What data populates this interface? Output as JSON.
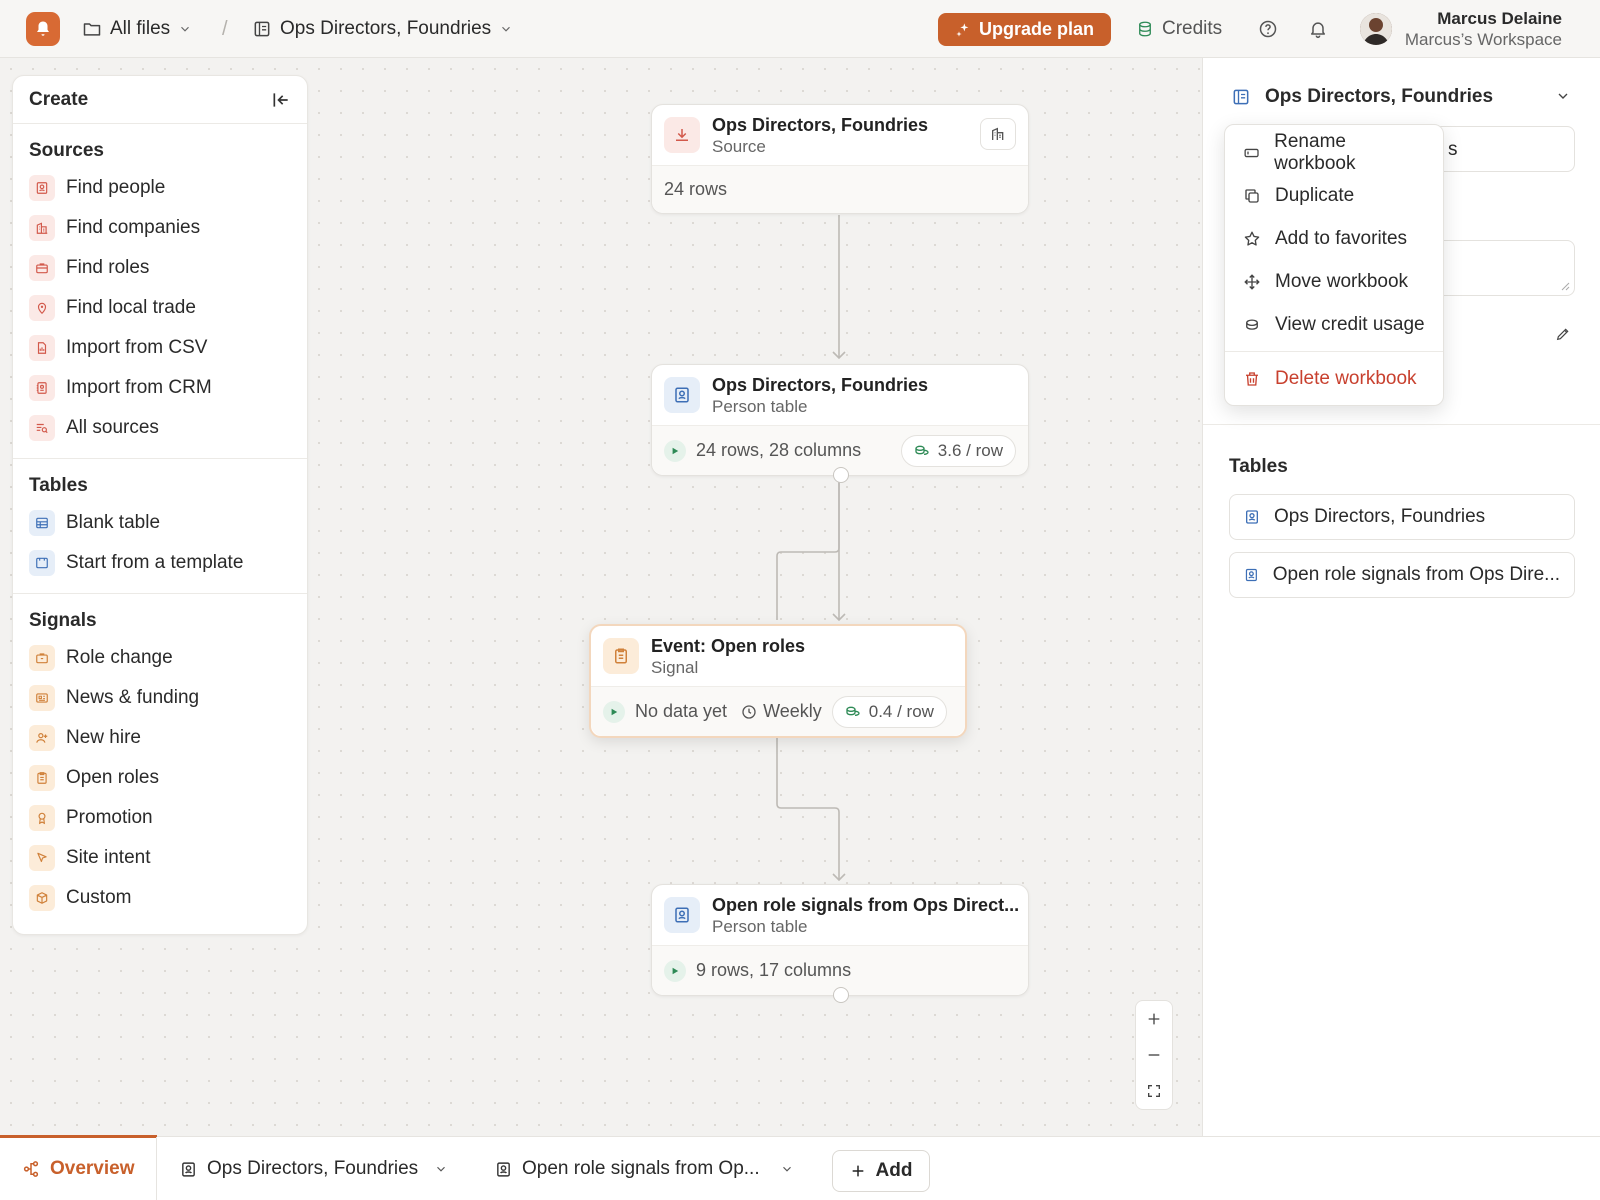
{
  "topbar": {
    "all_files": "All files",
    "workbook": "Ops Directors, Foundries",
    "upgrade": "Upgrade plan",
    "credits": "Credits",
    "user_name": "Marcus Delaine",
    "workspace": "Marcus’s Workspace"
  },
  "create": {
    "title": "Create",
    "sources_title": "Sources",
    "sources": [
      "Find people",
      "Find companies",
      "Find roles",
      "Find local trade",
      "Import from CSV",
      "Import from CRM",
      "All sources"
    ],
    "tables_title": "Tables",
    "tables": [
      "Blank table",
      "Start from a template"
    ],
    "signals_title": "Signals",
    "signals": [
      "Role change",
      "News & funding",
      "New hire",
      "Open roles",
      "Promotion",
      "Site intent",
      "Custom"
    ]
  },
  "nodes": {
    "source": {
      "title": "Ops Directors, Foundries",
      "sub": "Source",
      "rows": "24 rows"
    },
    "person": {
      "title": "Ops Directors, Foundries",
      "sub": "Person table",
      "stats": "24 rows, 28 columns",
      "cost": "3.6 / row"
    },
    "signal": {
      "title": "Event: Open roles",
      "sub": "Signal",
      "status": "No data yet",
      "freq": "Weekly",
      "cost": "0.4 / row"
    },
    "result": {
      "title": "Open role signals from Ops Direct...",
      "sub": "Person table",
      "stats": "9 rows, 17 columns"
    }
  },
  "right_panel": {
    "title": "Ops Directors, Foundries",
    "field_tail": "s",
    "tables_title": "Tables",
    "tables": [
      "Ops Directors, Foundries",
      "Open role signals from Ops Dire..."
    ]
  },
  "menu": {
    "items": [
      "Rename workbook",
      "Duplicate",
      "Add to favorites",
      "Move workbook",
      "View credit usage"
    ],
    "delete": "Delete workbook"
  },
  "bottom": {
    "overview": "Overview",
    "tab1": "Ops Directors, Foundries",
    "tab2": "Open role signals from Op...",
    "add": "Add"
  },
  "colors": {
    "accent": "#c8602b",
    "danger": "#c8402e",
    "canvas": "#f3f2f0"
  }
}
